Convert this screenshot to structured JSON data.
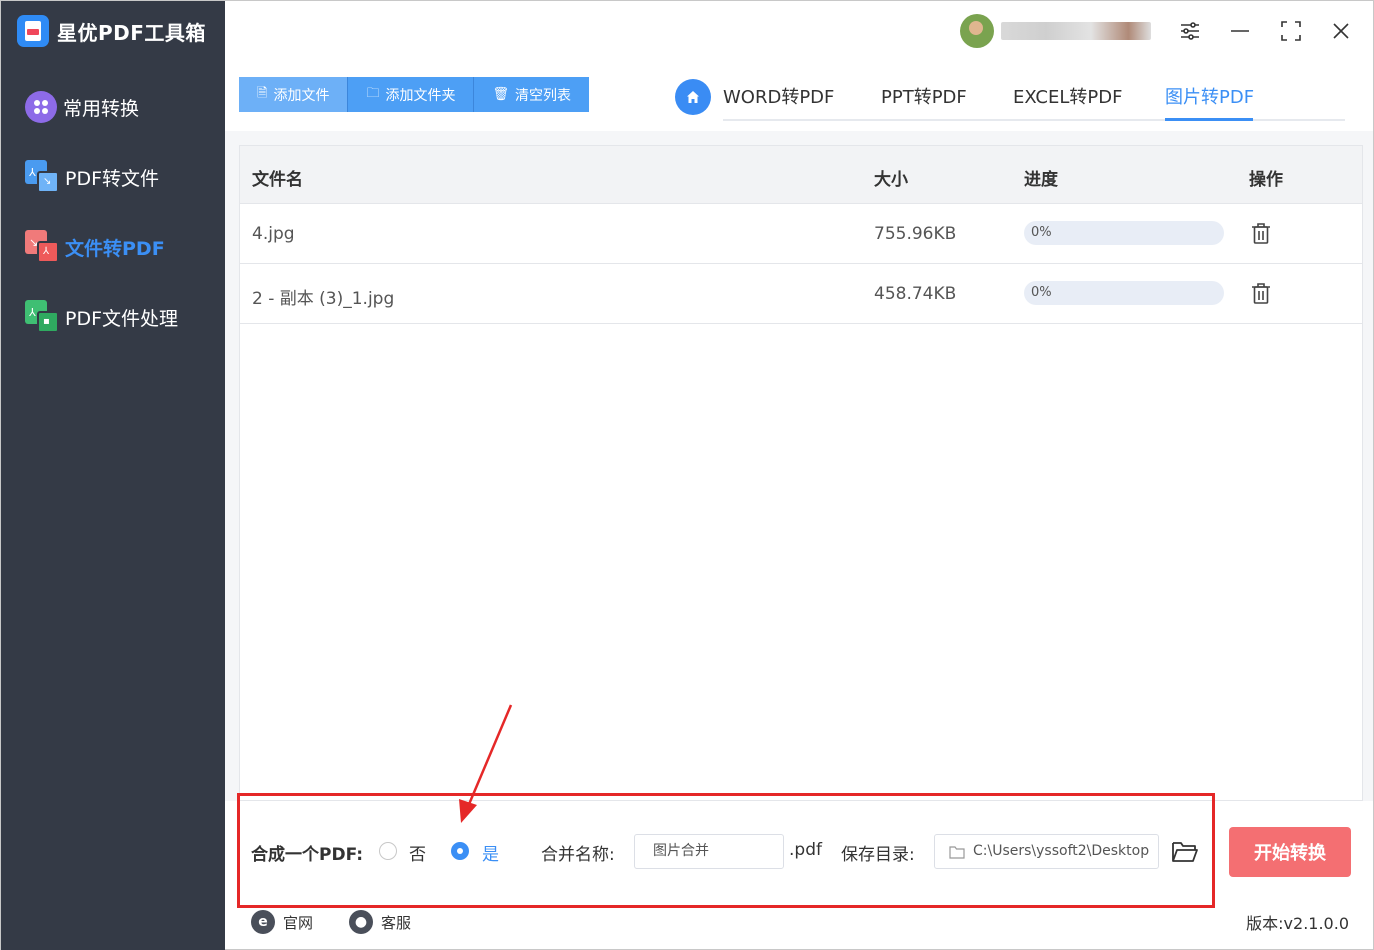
{
  "app": {
    "name": "星优PDF工具箱",
    "username": "yssoft2ahvd6"
  },
  "sidebar": {
    "items": [
      {
        "label": "常用转换",
        "icon": "grid-circle-icon",
        "active": false
      },
      {
        "label": "PDF转文件",
        "icon": "pdf-to-file-icon",
        "active": false
      },
      {
        "label": "文件转PDF",
        "icon": "file-to-pdf-icon",
        "active": true
      },
      {
        "label": "PDF文件处理",
        "icon": "pdf-process-icon",
        "active": false
      }
    ]
  },
  "toolbar": {
    "add_file": "添加文件",
    "add_folder": "添加文件夹",
    "clear_list": "清空列表"
  },
  "tabs": [
    {
      "label": "WORD转PDF",
      "active": false
    },
    {
      "label": "PPT转PDF",
      "active": false
    },
    {
      "label": "EXCEL转PDF",
      "active": false
    },
    {
      "label": "图片转PDF",
      "active": true
    }
  ],
  "table": {
    "headers": {
      "name": "文件名",
      "size": "大小",
      "progress": "进度",
      "action": "操作"
    },
    "rows": [
      {
        "name": "4.jpg",
        "size": "755.96KB",
        "progress_text": "0%",
        "progress": 0
      },
      {
        "name": "2 - 副本 (3)_1.jpg",
        "size": "458.74KB",
        "progress_text": "0%",
        "progress": 0
      }
    ]
  },
  "settings": {
    "merge_label": "合成一个PDF:",
    "option_no": "否",
    "option_yes": "是",
    "merge_selected": "是",
    "merge_name_label": "合并名称:",
    "merge_name_value": "图片合并",
    "ext": ".pdf",
    "save_dir_label": "保存目录:",
    "save_dir_value": "C:\\Users\\yssoft2\\Desktop",
    "start_button": "开始转换"
  },
  "footer": {
    "website": "官网",
    "support": "客服",
    "version": "版本:v2.1.0.0"
  },
  "colors": {
    "accent": "#3b8ff5",
    "sidebar_bg": "#343a46",
    "start_button": "#f46f72",
    "highlight": "#e52828"
  }
}
